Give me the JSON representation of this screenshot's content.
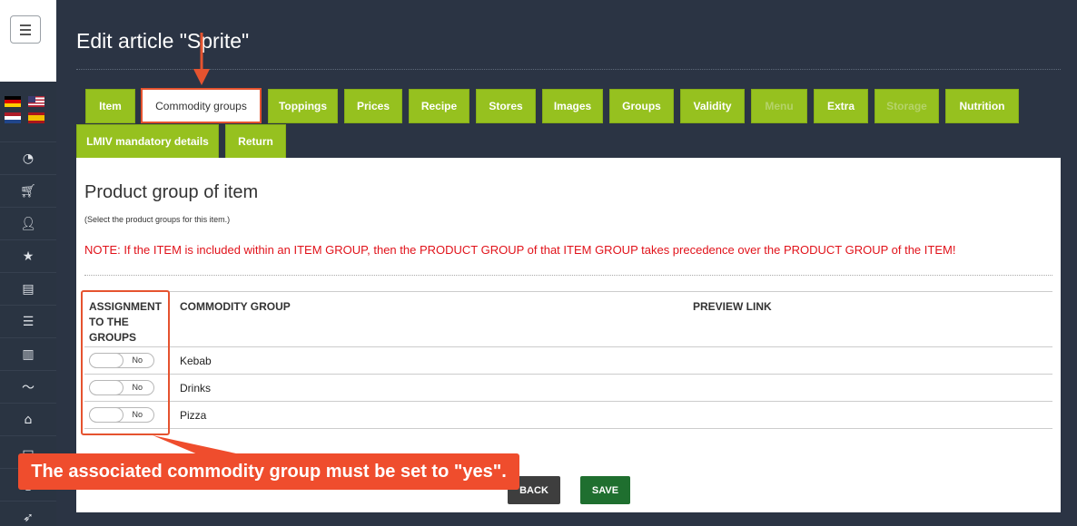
{
  "sidebar": {
    "icons": [
      "speedometer-icon",
      "cart-icon",
      "add-user-icon",
      "star-icon",
      "archive-icon",
      "list-icon",
      "book-icon",
      "chart-line-icon",
      "home-icon",
      "monitor-icon",
      "tablet-icon",
      "rocket-icon"
    ],
    "flags": [
      "de",
      "us",
      "nl",
      "es"
    ]
  },
  "page": {
    "title": "Edit article \"Sprite\""
  },
  "tabs_row1": [
    {
      "label": "Item",
      "state": "normal"
    },
    {
      "label": "Commodity groups",
      "state": "active"
    },
    {
      "label": "Toppings",
      "state": "normal"
    },
    {
      "label": "Prices",
      "state": "normal"
    },
    {
      "label": "Recipe",
      "state": "normal"
    },
    {
      "label": "Stores",
      "state": "normal"
    },
    {
      "label": "Images",
      "state": "normal"
    },
    {
      "label": "Groups",
      "state": "normal"
    },
    {
      "label": "Validity",
      "state": "normal"
    },
    {
      "label": "Menu",
      "state": "disabled"
    },
    {
      "label": "Extra",
      "state": "normal"
    },
    {
      "label": "Storage",
      "state": "disabled"
    },
    {
      "label": "Nutrition",
      "state": "normal"
    }
  ],
  "tabs_row2": [
    {
      "label": "LMIV mandatory details",
      "state": "normal"
    },
    {
      "label": "Return",
      "state": "normal"
    }
  ],
  "section": {
    "title": "Product group of item",
    "subtitle": "(Select the product groups for this item.)",
    "note": "NOTE: If the ITEM is included within an ITEM GROUP, then the PRODUCT GROUP of that ITEM GROUP takes precedence over the PRODUCT GROUP of the ITEM!"
  },
  "table": {
    "headers": {
      "assignment_line1": "ASSIGNMENT",
      "assignment_line2": "TO THE",
      "assignment_line3": "GROUPS",
      "commodity_group": "COMMODITY GROUP",
      "preview_link": "PREVIEW LINK"
    },
    "rows": [
      {
        "toggle": "No",
        "name": "Kebab"
      },
      {
        "toggle": "No",
        "name": "Drinks"
      },
      {
        "toggle": "No",
        "name": "Pizza"
      }
    ]
  },
  "buttons": {
    "back": "BACK",
    "save": "SAVE"
  },
  "annotation": {
    "callout_text": "The associated commodity group must be set to \"yes\".",
    "color": "#ef4d2d"
  },
  "colors": {
    "tab_green": "#96c11f",
    "note_red": "#e1121a",
    "save_green": "#1f6f2f"
  }
}
